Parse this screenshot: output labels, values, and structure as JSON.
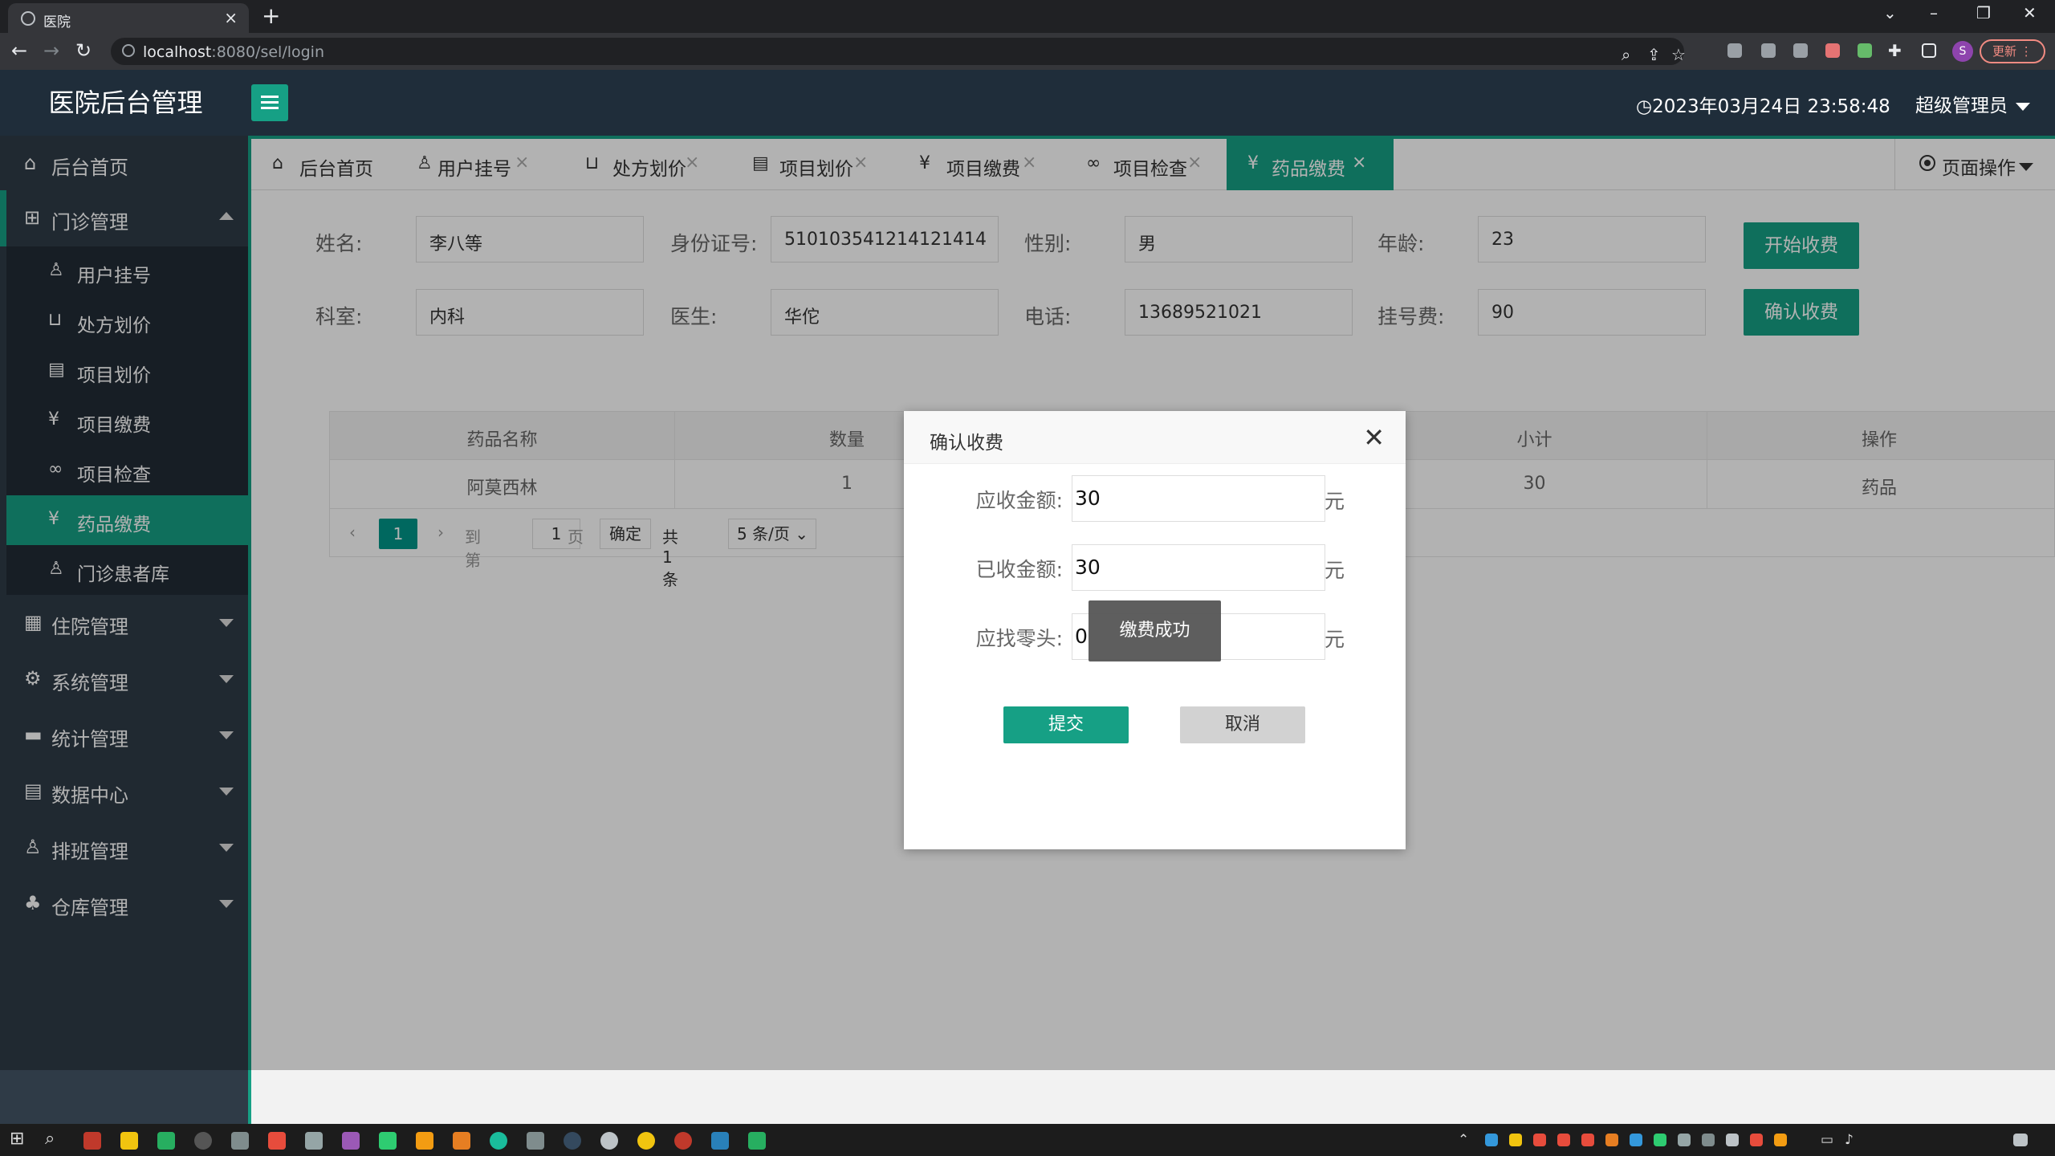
{
  "browser": {
    "tab_title": "医院",
    "url_host": "localhost",
    "url_path": ":8080/sel/login",
    "update_label": "更新",
    "profile_initial": "S"
  },
  "header": {
    "title": "医院后台管理",
    "clock": "2023年03月24日 23:58:48",
    "user": "超级管理员"
  },
  "sidebar": {
    "home": "后台首页",
    "outpatient": "门诊管理",
    "sub_items": [
      "用户挂号",
      "处方划价",
      "项目划价",
      "项目缴费",
      "项目检查",
      "药品缴费",
      "门诊患者库"
    ],
    "groups": [
      "住院管理",
      "系统管理",
      "统计管理",
      "数据中心",
      "排班管理",
      "仓库管理"
    ]
  },
  "page_tabs": [
    "后台首页",
    "用户挂号",
    "处方划价",
    "项目划价",
    "项目缴费",
    "项目检查",
    "药品缴费"
  ],
  "page_ops": "页面操作",
  "form": {
    "name_label": "姓名:",
    "name": "李八等",
    "id_label": "身份证号:",
    "id": "510103541214121414",
    "gender_label": "性别:",
    "gender": "男",
    "age_label": "年龄:",
    "age": "23",
    "dept_label": "科室:",
    "dept": "内科",
    "doctor_label": "医生:",
    "doctor": "华佗",
    "phone_label": "电话:",
    "phone": "13689521021",
    "fee_label": "挂号费:",
    "fee": "90",
    "start_btn": "开始收费",
    "confirm_btn": "确认收费"
  },
  "table": {
    "headers": [
      "药品名称",
      "数量",
      "小计",
      "操作"
    ],
    "rows": [
      [
        "阿莫西林",
        "1",
        "30",
        "药品"
      ]
    ]
  },
  "pager": {
    "prev": "‹",
    "page": "1",
    "next": "›",
    "goto_label": "到第",
    "goto_value": "1",
    "page_unit": "页",
    "ok": "确定",
    "total": "共 1 条",
    "per_page": "5 条/页"
  },
  "modal": {
    "title": "确认收费",
    "receivable_label": "应收金额:",
    "receivable": "30",
    "received_label": "已收金额:",
    "received": "30",
    "change_label": "应找零头:",
    "change": "0",
    "unit": "元",
    "submit": "提交",
    "cancel": "取消",
    "toast": "缴费成功"
  },
  "colors": {
    "accent": "#16a085",
    "header_bg": "#1f2d3a",
    "sidebar_bg": "#2f3b47"
  }
}
